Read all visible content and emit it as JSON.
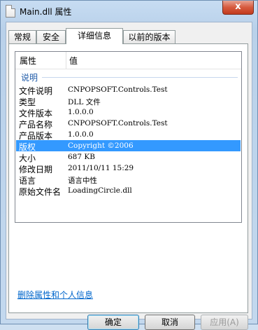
{
  "window": {
    "title": "Main.dll 属性",
    "close_label": "x"
  },
  "tabs": [
    {
      "label": "常规"
    },
    {
      "label": "安全"
    },
    {
      "label": "详细信息"
    },
    {
      "label": "以前的版本"
    }
  ],
  "list": {
    "header_property": "属性",
    "header_value": "值",
    "group_label": "说明",
    "rows": [
      {
        "key": "文件说明",
        "value": "CNPOPSOFT.Controls.Test"
      },
      {
        "key": "类型",
        "value": "DLL 文件"
      },
      {
        "key": "文件版本",
        "value": "1.0.0.0"
      },
      {
        "key": "产品名称",
        "value": "CNPOPSOFT.Controls.Test"
      },
      {
        "key": "产品版本",
        "value": "1.0.0.0"
      },
      {
        "key": "版权",
        "value": "Copyright ©2006"
      },
      {
        "key": "大小",
        "value": "687 KB"
      },
      {
        "key": "修改日期",
        "value": "2011/10/11 15:29"
      },
      {
        "key": "语言",
        "value": "语言中性"
      },
      {
        "key": "原始文件名",
        "value": "LoadingCircle.dll"
      }
    ]
  },
  "remove_link": "删除属性和个人信息",
  "buttons": {
    "ok": "确定",
    "cancel": "取消",
    "apply": "应用(A)"
  }
}
